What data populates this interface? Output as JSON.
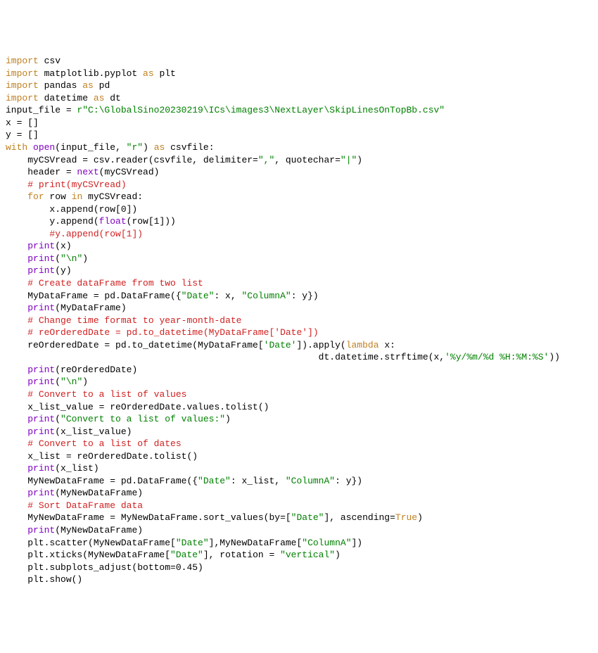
{
  "lines": [
    {
      "cls": "",
      "segs": [
        {
          "cls": "kw",
          "t": "import"
        },
        {
          "cls": "",
          "t": " csv"
        }
      ]
    },
    {
      "cls": "",
      "segs": [
        {
          "cls": "kw",
          "t": "import"
        },
        {
          "cls": "",
          "t": " matplotlib.pyplot "
        },
        {
          "cls": "kw",
          "t": "as"
        },
        {
          "cls": "",
          "t": " plt"
        }
      ]
    },
    {
      "cls": "",
      "segs": [
        {
          "cls": "kw",
          "t": "import"
        },
        {
          "cls": "",
          "t": " pandas "
        },
        {
          "cls": "kw",
          "t": "as"
        },
        {
          "cls": "",
          "t": " pd"
        }
      ]
    },
    {
      "cls": "",
      "segs": [
        {
          "cls": "kw",
          "t": "import"
        },
        {
          "cls": "",
          "t": " datetime "
        },
        {
          "cls": "kw",
          "t": "as"
        },
        {
          "cls": "",
          "t": " dt"
        }
      ]
    },
    {
      "cls": "",
      "segs": [
        {
          "cls": "",
          "t": ""
        }
      ]
    },
    {
      "cls": "",
      "segs": [
        {
          "cls": "",
          "t": ""
        }
      ]
    },
    {
      "cls": "",
      "segs": [
        {
          "cls": "",
          "t": "input_file = "
        },
        {
          "cls": "str",
          "t": "r\"C:\\GlobalSino20230219\\ICs\\images3\\NextLayer\\SkipLinesOnTopBb.csv\""
        }
      ]
    },
    {
      "cls": "",
      "segs": [
        {
          "cls": "",
          "t": ""
        }
      ]
    },
    {
      "cls": "",
      "segs": [
        {
          "cls": "",
          "t": "x = []"
        }
      ]
    },
    {
      "cls": "",
      "segs": [
        {
          "cls": "",
          "t": "y = []"
        }
      ]
    },
    {
      "cls": "",
      "segs": [
        {
          "cls": "",
          "t": ""
        }
      ]
    },
    {
      "cls": "",
      "segs": [
        {
          "cls": "kw",
          "t": "with"
        },
        {
          "cls": "",
          "t": " "
        },
        {
          "cls": "builtin",
          "t": "open"
        },
        {
          "cls": "",
          "t": "(input_file, "
        },
        {
          "cls": "str",
          "t": "\"r\""
        },
        {
          "cls": "",
          "t": ") "
        },
        {
          "cls": "kw",
          "t": "as"
        },
        {
          "cls": "",
          "t": " csvfile:"
        }
      ]
    },
    {
      "cls": "",
      "segs": [
        {
          "cls": "",
          "t": "    myCSVread = csv.reader(csvfile, delimiter="
        },
        {
          "cls": "str",
          "t": "\",\""
        },
        {
          "cls": "",
          "t": ", quotechar="
        },
        {
          "cls": "str",
          "t": "\"|\""
        },
        {
          "cls": "",
          "t": ")"
        }
      ]
    },
    {
      "cls": "",
      "segs": [
        {
          "cls": "",
          "t": ""
        }
      ]
    },
    {
      "cls": "",
      "segs": [
        {
          "cls": "",
          "t": "    header = "
        },
        {
          "cls": "builtin",
          "t": "next"
        },
        {
          "cls": "",
          "t": "(myCSVread)"
        }
      ]
    },
    {
      "cls": "",
      "segs": [
        {
          "cls": "",
          "t": "    "
        },
        {
          "cls": "comment",
          "t": "# print(myCSVread)"
        }
      ]
    },
    {
      "cls": "",
      "segs": [
        {
          "cls": "",
          "t": "    "
        },
        {
          "cls": "kw",
          "t": "for"
        },
        {
          "cls": "",
          "t": " row "
        },
        {
          "cls": "kw",
          "t": "in"
        },
        {
          "cls": "",
          "t": " myCSVread:"
        }
      ]
    },
    {
      "cls": "",
      "segs": [
        {
          "cls": "",
          "t": "        x.append(row[0])"
        }
      ]
    },
    {
      "cls": "",
      "segs": [
        {
          "cls": "",
          "t": "        y.append("
        },
        {
          "cls": "builtin",
          "t": "float"
        },
        {
          "cls": "",
          "t": "(row[1]))"
        }
      ]
    },
    {
      "cls": "",
      "segs": [
        {
          "cls": "",
          "t": "        "
        },
        {
          "cls": "comment",
          "t": "#y.append(row[1])"
        }
      ]
    },
    {
      "cls": "",
      "segs": [
        {
          "cls": "",
          "t": "    "
        },
        {
          "cls": "builtin",
          "t": "print"
        },
        {
          "cls": "",
          "t": "(x)"
        }
      ]
    },
    {
      "cls": "",
      "segs": [
        {
          "cls": "",
          "t": "    "
        },
        {
          "cls": "builtin",
          "t": "print"
        },
        {
          "cls": "",
          "t": "("
        },
        {
          "cls": "str",
          "t": "\"\\n\""
        },
        {
          "cls": "",
          "t": ")"
        }
      ]
    },
    {
      "cls": "",
      "segs": [
        {
          "cls": "",
          "t": "    "
        },
        {
          "cls": "builtin",
          "t": "print"
        },
        {
          "cls": "",
          "t": "(y)"
        }
      ]
    },
    {
      "cls": "",
      "segs": [
        {
          "cls": "",
          "t": ""
        }
      ]
    },
    {
      "cls": "",
      "segs": [
        {
          "cls": "",
          "t": "    "
        },
        {
          "cls": "comment",
          "t": "# Create dataFrame from two list"
        }
      ]
    },
    {
      "cls": "",
      "segs": [
        {
          "cls": "",
          "t": "    MyDataFrame = pd.DataFrame({"
        },
        {
          "cls": "str",
          "t": "\"Date\""
        },
        {
          "cls": "",
          "t": ": x, "
        },
        {
          "cls": "str",
          "t": "\"ColumnA\""
        },
        {
          "cls": "",
          "t": ": y})"
        }
      ]
    },
    {
      "cls": "",
      "segs": [
        {
          "cls": "",
          "t": "    "
        },
        {
          "cls": "builtin",
          "t": "print"
        },
        {
          "cls": "",
          "t": "(MyDataFrame)"
        }
      ]
    },
    {
      "cls": "",
      "segs": [
        {
          "cls": "",
          "t": "    "
        },
        {
          "cls": "comment",
          "t": "# Change time format to year-month-date"
        }
      ]
    },
    {
      "cls": "",
      "segs": [
        {
          "cls": "",
          "t": "    "
        },
        {
          "cls": "comment",
          "t": "# reOrderedDate = pd.to_datetime(MyDataFrame['Date'])"
        }
      ]
    },
    {
      "cls": "",
      "segs": [
        {
          "cls": "",
          "t": "    reOrderedDate = pd.to_datetime(MyDataFrame["
        },
        {
          "cls": "str",
          "t": "'Date'"
        },
        {
          "cls": "",
          "t": "]).apply("
        },
        {
          "cls": "kw",
          "t": "lambda"
        },
        {
          "cls": "",
          "t": " x:"
        }
      ]
    },
    {
      "cls": "",
      "segs": [
        {
          "cls": "",
          "t": "                                                         dt.datetime.strftime(x,"
        },
        {
          "cls": "str",
          "t": "'%y/%m/%d %H:%M:%S'"
        },
        {
          "cls": "",
          "t": "))"
        }
      ]
    },
    {
      "cls": "",
      "segs": [
        {
          "cls": "",
          "t": "    "
        },
        {
          "cls": "builtin",
          "t": "print"
        },
        {
          "cls": "",
          "t": "(reOrderedDate)"
        }
      ]
    },
    {
      "cls": "",
      "segs": [
        {
          "cls": "",
          "t": ""
        }
      ]
    },
    {
      "cls": "",
      "segs": [
        {
          "cls": "",
          "t": "    "
        },
        {
          "cls": "builtin",
          "t": "print"
        },
        {
          "cls": "",
          "t": "("
        },
        {
          "cls": "str",
          "t": "\"\\n\""
        },
        {
          "cls": "",
          "t": ")"
        }
      ]
    },
    {
      "cls": "",
      "segs": [
        {
          "cls": "",
          "t": "    "
        },
        {
          "cls": "comment",
          "t": "# Convert to a list of values"
        }
      ]
    },
    {
      "cls": "",
      "segs": [
        {
          "cls": "",
          "t": "    x_list_value = reOrderedDate.values.tolist()"
        }
      ]
    },
    {
      "cls": "",
      "segs": [
        {
          "cls": "",
          "t": "    "
        },
        {
          "cls": "builtin",
          "t": "print"
        },
        {
          "cls": "",
          "t": "("
        },
        {
          "cls": "str",
          "t": "\"Convert to a list of values:\""
        },
        {
          "cls": "",
          "t": ")"
        }
      ]
    },
    {
      "cls": "",
      "segs": [
        {
          "cls": "",
          "t": "    "
        },
        {
          "cls": "builtin",
          "t": "print"
        },
        {
          "cls": "",
          "t": "(x_list_value)"
        }
      ]
    },
    {
      "cls": "",
      "segs": [
        {
          "cls": "",
          "t": ""
        }
      ]
    },
    {
      "cls": "",
      "segs": [
        {
          "cls": "",
          "t": "    "
        },
        {
          "cls": "comment",
          "t": "# Convert to a list of dates"
        }
      ]
    },
    {
      "cls": "",
      "segs": [
        {
          "cls": "",
          "t": "    x_list = reOrderedDate.tolist()"
        }
      ]
    },
    {
      "cls": "",
      "segs": [
        {
          "cls": "",
          "t": "    "
        },
        {
          "cls": "builtin",
          "t": "print"
        },
        {
          "cls": "",
          "t": "(x_list)"
        }
      ]
    },
    {
      "cls": "",
      "segs": [
        {
          "cls": "",
          "t": ""
        }
      ]
    },
    {
      "cls": "",
      "segs": [
        {
          "cls": "",
          "t": "    MyNewDataFrame = pd.DataFrame({"
        },
        {
          "cls": "str",
          "t": "\"Date\""
        },
        {
          "cls": "",
          "t": ": x_list, "
        },
        {
          "cls": "str",
          "t": "\"ColumnA\""
        },
        {
          "cls": "",
          "t": ": y})"
        }
      ]
    },
    {
      "cls": "",
      "segs": [
        {
          "cls": "",
          "t": ""
        }
      ]
    },
    {
      "cls": "",
      "segs": [
        {
          "cls": "",
          "t": "    "
        },
        {
          "cls": "builtin",
          "t": "print"
        },
        {
          "cls": "",
          "t": "(MyNewDataFrame)"
        }
      ]
    },
    {
      "cls": "",
      "segs": [
        {
          "cls": "",
          "t": ""
        }
      ]
    },
    {
      "cls": "",
      "segs": [
        {
          "cls": "",
          "t": "    "
        },
        {
          "cls": "comment",
          "t": "# Sort DataFrame data"
        }
      ]
    },
    {
      "cls": "",
      "segs": [
        {
          "cls": "",
          "t": "    MyNewDataFrame = MyNewDataFrame.sort_values(by=["
        },
        {
          "cls": "str",
          "t": "\"Date\""
        },
        {
          "cls": "",
          "t": "], ascending="
        },
        {
          "cls": "const",
          "t": "True"
        },
        {
          "cls": "",
          "t": ")"
        }
      ]
    },
    {
      "cls": "",
      "segs": [
        {
          "cls": "",
          "t": ""
        }
      ]
    },
    {
      "cls": "",
      "segs": [
        {
          "cls": "",
          "t": "    "
        },
        {
          "cls": "builtin",
          "t": "print"
        },
        {
          "cls": "",
          "t": "(MyNewDataFrame)"
        }
      ]
    },
    {
      "cls": "",
      "segs": [
        {
          "cls": "",
          "t": ""
        }
      ]
    },
    {
      "cls": "",
      "segs": [
        {
          "cls": "",
          "t": "    plt.scatter(MyNewDataFrame["
        },
        {
          "cls": "str",
          "t": "\"Date\""
        },
        {
          "cls": "",
          "t": "],MyNewDataFrame["
        },
        {
          "cls": "str",
          "t": "\"ColumnA\""
        },
        {
          "cls": "",
          "t": "])"
        }
      ]
    },
    {
      "cls": "",
      "segs": [
        {
          "cls": "",
          "t": ""
        }
      ]
    },
    {
      "cls": "",
      "segs": [
        {
          "cls": "",
          "t": "    plt.xticks(MyNewDataFrame["
        },
        {
          "cls": "str",
          "t": "\"Date\""
        },
        {
          "cls": "",
          "t": "], rotation = "
        },
        {
          "cls": "str",
          "t": "\"vertical\""
        },
        {
          "cls": "",
          "t": ")"
        }
      ]
    },
    {
      "cls": "",
      "segs": [
        {
          "cls": "",
          "t": "    plt.subplots_adjust(bottom=0.45)"
        }
      ]
    },
    {
      "cls": "",
      "segs": [
        {
          "cls": "",
          "t": "    plt.show()"
        }
      ]
    }
  ]
}
